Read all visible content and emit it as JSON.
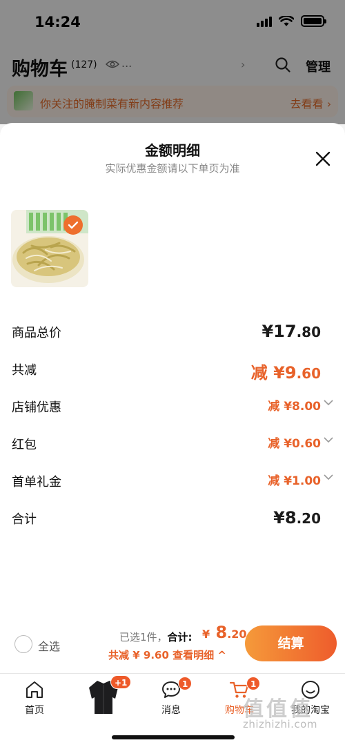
{
  "status_bar": {
    "time": "14:24"
  },
  "cart_header": {
    "title": "购物车",
    "count": "(127)",
    "dots": "...",
    "manage": "管理"
  },
  "banner": {
    "text": "你关注的腌制菜有新内容推荐",
    "go": "去看看"
  },
  "sheet": {
    "title": "金额明细",
    "subtitle": "实际优惠金额请以下单页为准",
    "rows": [
      {
        "label": "商品总价",
        "yen": "¥17",
        "cents": ".80"
      },
      {
        "label": "共减",
        "prefix": "减 ",
        "yen": "¥9",
        "cents": ".60"
      },
      {
        "label": "店铺优惠",
        "value": "减 ¥8.00"
      },
      {
        "label": "红包",
        "value": "减 ¥0.60"
      },
      {
        "label": "首单礼金",
        "value": "减 ¥1.00"
      },
      {
        "label": "合计",
        "yen": "¥8",
        "cents": ".20"
      }
    ]
  },
  "checkout": {
    "select_all": "全选",
    "selected": "已选1件，",
    "total_label": "合计:",
    "currency": "¥",
    "amount_int": "8",
    "amount_cents": ".20",
    "discount": "共减 ¥ 9.60  查看明细 ^",
    "button": "结算"
  },
  "tabbar": {
    "home": "首页",
    "item_badge": "+1",
    "messages": "消息",
    "messages_badge": "1",
    "cart": "购物车",
    "cart_badge": "1",
    "mine": "我的淘宝"
  },
  "watermark": {
    "logo": "值值值",
    "text": "zhizhizhi.com"
  },
  "colors": {
    "accent": "#e8622a",
    "button_start": "#f59a3a",
    "button_end": "#ee5c2c"
  }
}
